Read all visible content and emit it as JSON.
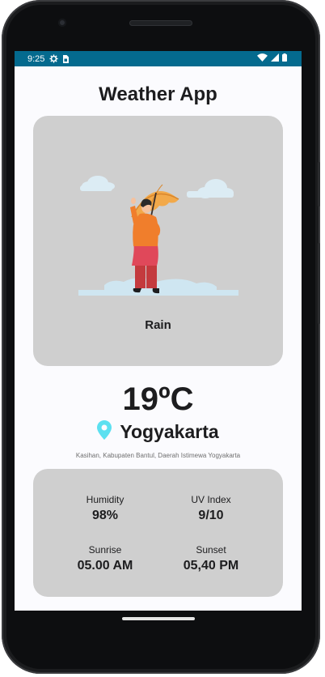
{
  "status_bar": {
    "time": "9:25",
    "icons_left": [
      "settings-icon",
      "sim-card-icon"
    ],
    "icons_right": [
      "wifi-icon",
      "signal-icon",
      "battery-icon"
    ],
    "color": "#046a8e"
  },
  "app": {
    "title": "Weather App"
  },
  "weather": {
    "condition": "Rain",
    "temperature": "19ºC",
    "city": "Yogyakarta",
    "address": "Kasihan, Kabupaten Bantul, Daerah Istimewa Yogyakarta"
  },
  "stats": {
    "humidity": {
      "label": "Humidity",
      "value": "98%"
    },
    "uv_index": {
      "label": "UV Index",
      "value": "9/10"
    },
    "sunrise": {
      "label": "Sunrise",
      "value": "05.00 AM"
    },
    "sunset": {
      "label": "Sunset",
      "value": "05,40 PM"
    }
  },
  "colors": {
    "card_bg": "#cfcfcf",
    "location_pin": "#5ce0f0",
    "screen_bg": "#fbfbfe"
  }
}
